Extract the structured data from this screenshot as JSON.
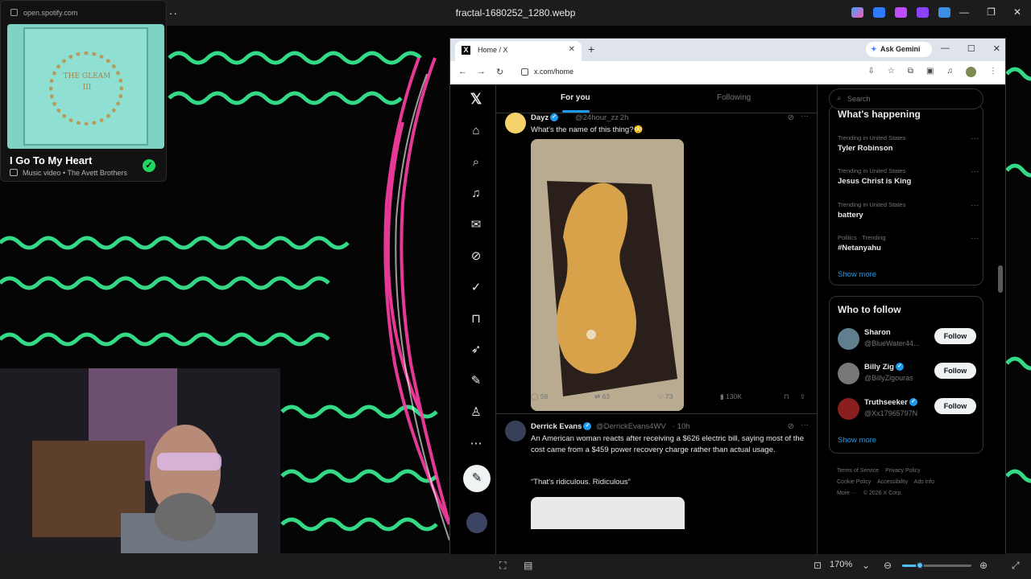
{
  "photos": {
    "window_title": "fractal-1680252_1280.webp",
    "menu_label": "···",
    "zoom_level": "170%",
    "zoom_fraction": 0.25
  },
  "spotify": {
    "url": "open.spotify.com",
    "album_text": "THE GLEAM III",
    "song_title": "I Go To My Heart",
    "subtitle": "Music video • The Avett Brothers"
  },
  "browser": {
    "tab_title": "Home / X",
    "gemini_label": "Ask Gemini",
    "url": "x.com/home"
  },
  "x": {
    "tabs": {
      "for_you": "For you",
      "following": "Following"
    },
    "tweets": [
      {
        "name": "Dayz",
        "handle": "@24hour_zz",
        "time": "· 2h",
        "text": "What's the name of this thing?😳",
        "replies": "58",
        "reposts": "63",
        "likes": "73",
        "views": "130K"
      },
      {
        "name": "Derrick Evans",
        "handle": "@DerrickEvans4WV",
        "time": "· 10h",
        "text": "An American woman reacts after receiving a $626 electric bill, saying most of the cost came from a $459 power recovery charge rather than actual usage.",
        "quote": "“That's ridiculous. Ridiculous”"
      }
    ],
    "search_placeholder": "Search",
    "happening_title": "What's happening",
    "trends": [
      {
        "context": "Trending in United States",
        "name": "Tyler Robinson"
      },
      {
        "context": "Trending in United States",
        "name": "Jesus Christ is King"
      },
      {
        "context": "Trending in United States",
        "name": "battery"
      },
      {
        "context": "Politics · Trending",
        "name": "#Netanyahu"
      }
    ],
    "show_more": "Show more",
    "who_to_follow_title": "Who to follow",
    "follow": [
      {
        "name": "Sharon",
        "handle": "@BlueWater44...",
        "button": "Follow"
      },
      {
        "name": "Billy Zig",
        "handle": "@BillyZigouras",
        "button": "Follow"
      },
      {
        "name": "Truthseeker",
        "handle": "@Xx17965797N",
        "button": "Follow"
      }
    ],
    "footer": [
      "Terms of Service",
      "Privacy Policy",
      "Cookie Policy",
      "Accessibility",
      "Ads info",
      "More ···",
      "© 2026 X Corp."
    ]
  },
  "colors": {
    "x_blue": "#1d9bf0",
    "spotify_green": "#1ed760",
    "fractal_green": "#3dff9e",
    "fractal_pink": "#ff3fa5"
  }
}
